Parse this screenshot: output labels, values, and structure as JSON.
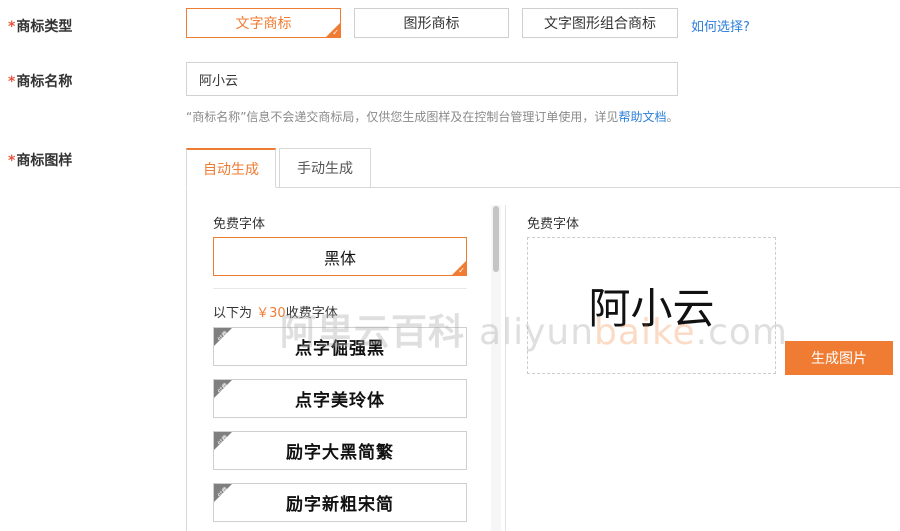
{
  "fields": {
    "type_label": "商标类型",
    "name_label": "商标名称",
    "pattern_label": "商标图样",
    "required_mark": "*"
  },
  "type_options": [
    {
      "label": "文字商标",
      "selected": true
    },
    {
      "label": "图形商标",
      "selected": false
    },
    {
      "label": "文字图形组合商标",
      "selected": false
    }
  ],
  "how_to_choose_link": "如何选择?",
  "name_input": {
    "value": "阿小云",
    "placeholder": ""
  },
  "help": {
    "text": "“商标名称”信息不会递交商标局，仅供您生成图样及在控制台管理订单使用，详见",
    "link": "帮助文档",
    "suffix": "。"
  },
  "tabs": [
    {
      "label": "自动生成",
      "active": true
    },
    {
      "label": "手动生成",
      "active": false
    }
  ],
  "free_fonts": {
    "label": "免费字体",
    "items": [
      {
        "name": "黑体",
        "selected": true
      }
    ]
  },
  "paid_fonts": {
    "label_prefix": "以下为",
    "price": "￥30",
    "label_suffix": "收费字体",
    "badge": "付费",
    "items": [
      {
        "name": "点字倔强黑"
      },
      {
        "name": "点字美玲体"
      },
      {
        "name": "励字大黑简繁"
      },
      {
        "name": "励字新粗宋简"
      }
    ]
  },
  "preview": {
    "label": "免费字体",
    "text": "阿小云",
    "button": "生成图片"
  },
  "watermark": {
    "cn": "阿里云百科",
    "url_part1": "aliyun",
    "url_part2": "baike",
    "url_part3": ".com"
  },
  "colors": {
    "accent": "#f07c33",
    "link": "#2d7fd8",
    "required": "#e8553d"
  }
}
